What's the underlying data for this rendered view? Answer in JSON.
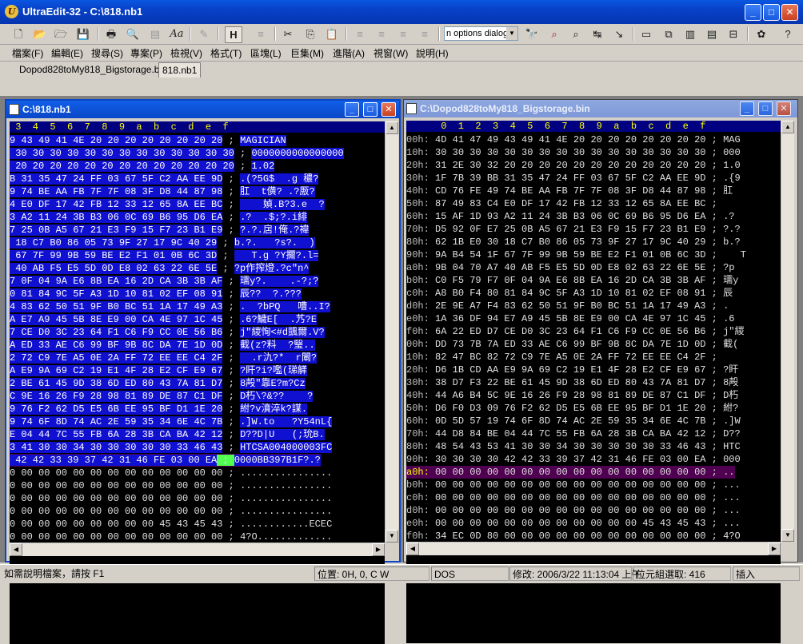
{
  "window": {
    "title": "UltraEdit-32 - C:\\818.nb1"
  },
  "toolbar": {
    "search_combo": "n options dialog"
  },
  "menu": [
    "檔案(F)",
    "編輯(E)",
    "搜尋(S)",
    "專案(P)",
    "檢視(V)",
    "格式(T)",
    "區塊(L)",
    "巨集(M)",
    "進階(A)",
    "視窗(W)",
    "說明(H)"
  ],
  "tabs": [
    "Dopod828toMy818_Bigstorage.bin",
    "818.nb1"
  ],
  "left_pane": {
    "title": "C:\\818.nb1",
    "header": " 3  4  5  6  7  8  9  a  b  c  d  e  f",
    "rows": [
      [
        "9 43 49 41 4E 20 20 20 20 20 20 20 20",
        "MAGICIAN"
      ],
      [
        " 30 30 30 30 30 30 30 30 30 30 30 30 30",
        "0000000000000000"
      ],
      [
        " 20 20 20 20 20 20 20 20 20 20 20 20 20",
        "1.02"
      ],
      [
        "B 31 35 47 24 FF 03 67 5F C2 AA EE 9D",
        ".(?5G$  .g 穠?"
      ],
      [
        "9 74 BE AA FB 7F 7F 08 3F D8 44 87 98",
        "肛  t僙? .?厫?"
      ],
      [
        "4 E0 DF 17 42 FB 12 33 12 65 8A EE BC",
        "    媜.B?3.e  ?"
      ],
      [
        "3 A2 11 24 3B B3 06 0C 69 B6 95 D6 EA",
        ".?  .$;?.i緋"
      ],
      [
        "7 25 0B A5 67 21 E3 F9 15 F7 23 B1 E9",
        "?.?.扂!俺.?禕"
      ],
      [
        " 18 C7 B0 86 05 73 9F 27 17 9C 40 29",
        "b.?.   ?s?.  )"
      ],
      [
        " 67 7F 99 9B 59 BE E2 F1 01 0B 6C 3D",
        "   T.g ?Y擟?.l="
      ],
      [
        " 40 AB F5 E5 5D 0D E8 02 63 22 6E 5E",
        "?p作搾燈.?c\"n^"
      ],
      [
        "7 0F 04 9A E6 8B EA 16 2D CA 3B 3B AF",
        "瓀y?.    .-?;?"
      ],
      [
        "0 81 84 9C 5F A3 1D 10 81 02 EF 08 91",
        "辰??  ?.???"
      ],
      [
        "4 83 62 50 51 9F B0 BC 51 1A 17 49 A3",
        ".  ?bPQ   嘈..I?"
      ],
      [
        "A E7 A9 45 5B 8E E9 00 CA 4E 97 1C 45",
        ".6?鱥E[  .艿?E"
      ],
      [
        "7 CE D0 3C 23 64 F1 C6 F9 CC 0E 56 B6",
        "j\"緵恂<#d颽爾.V?"
      ],
      [
        "A ED 33 AE C6 99 BF 9B 8C DA 7E 1D 0D",
        "截(z?料  ?瑿.."
      ],
      [
        "2 72 C9 7E A5 0E 2A FF 72 EE EE C4 2F",
        "  .r氿?*  r閳?"
      ],
      [
        "A E9 9A 69 C2 19 E1 4F 28 E2 CF E9 67",
        "?盰?i?嚂(珶觲"
      ],
      [
        "2 BE 61 45 9D 38 6D ED 80 43 7A 81 D7",
        "8殸\"靠E?m?Cz"
      ],
      [
        "C 9E 16 26 F9 28 98 81 89 DE 87 C1 DF",
        "D朽\\?&??    ?"
      ],
      [
        "9 76 F2 62 D5 E5 6B EE 95 BF D1 1E 20",
        "紨?v濆淬k?謀."
      ],
      [
        "9 74 6F 8D 74 AC 2E 59 35 34 6E 4C 7B",
        ".]W.to   ?Y54nL{"
      ],
      [
        "E 04 44 7C 55 FB 6A 28 3B CA BA 42 12",
        "D??D|U   (;玧B."
      ],
      [
        "3 41 30 30 34 30 30 30 30 30 33 46 43",
        "HTCSA004000003FC"
      ],
      [
        " 42 42 33 39 37 42 31 46 FE 03 00 EA",
        "0000BB397B1F?.?"
      ],
      [
        "0 00 00 00 00 00 00 00 00 00 00 00 00",
        "................"
      ],
      [
        "0 00 00 00 00 00 00 00 00 00 00 00 00",
        "................"
      ],
      [
        "0 00 00 00 00 00 00 00 00 00 00 00 00",
        "................"
      ],
      [
        "0 00 00 00 00 00 00 00 00 00 00 00 00",
        "................"
      ],
      [
        "0 00 00 00 00 00 00 00 00 45 43 45 43",
        "............ECEC"
      ],
      [
        "0 00 00 00 00 00 00 00 00 00 00 00 00",
        "4?O............."
      ]
    ]
  },
  "right_pane": {
    "title": "C:\\Dopod828toMy818_Bigstorage.bin",
    "header": "      0  1  2  3  4  5  6  7  8  9  a  b  c  d  e  f",
    "rows": [
      [
        "00h:",
        "4D 41 47 49 43 49 41 4E 20 20 20 20 20 20 20 20",
        "MAG"
      ],
      [
        "10h:",
        "30 30 30 30 30 30 30 30 30 30 30 30 30 30 30 30",
        "000"
      ],
      [
        "20h:",
        "31 2E 30 32 20 20 20 20 20 20 20 20 20 20 20 20",
        "1.0"
      ],
      [
        "30h:",
        "1F 7B 39 BB 31 35 47 24 FF 03 67 5F C2 AA EE 9D",
        ".{9"
      ],
      [
        "40h:",
        "CD 76 FE 49 74 BE AA FB 7F 7F 08 3F D8 44 87 98",
        "肛"
      ],
      [
        "50h:",
        "87 49 83 C4 E0 DF 17 42 FB 12 33 12 65 8A EE BC",
        ""
      ],
      [
        "60h:",
        "15 AF 1D 93 A2 11 24 3B B3 06 0C 69 B6 95 D6 EA",
        ".?"
      ],
      [
        "70h:",
        "D5 92 0F E7 25 0B A5 67 21 E3 F9 15 F7 23 B1 E9",
        "?.?"
      ],
      [
        "80h:",
        "62 1B E0 30 18 C7 B0 86 05 73 9F 27 17 9C 40 29",
        "b.?"
      ],
      [
        "90h:",
        "9A B4 54 1F 67 7F 99 9B 59 BE E2 F1 01 0B 6C 3D",
        "   T"
      ],
      [
        "a0h:",
        "9B 04 70 A7 40 AB F5 E5 5D 0D E8 02 63 22 6E 5E",
        "?p"
      ],
      [
        "b0h:",
        "C0 F5 79 F7 0F 04 9A E6 8B EA 16 2D CA 3B 3B AF",
        "瓀y"
      ],
      [
        "c0h:",
        "A8 B0 F4 80 81 84 9C 5F A3 1D 10 81 02 EF 08 91",
        "辰"
      ],
      [
        "d0h:",
        "2E 9E A7 F4 83 62 50 51 9F B0 BC 51 1A 17 49 A3",
        "."
      ],
      [
        "e0h:",
        "1A 36 DF 94 E7 A9 45 5B 8E E9 00 CA 4E 97 1C 45",
        ".6"
      ],
      [
        "f0h:",
        "6A 22 ED D7 CE D0 3C 23 64 F1 C6 F9 CC 0E 56 B6",
        "j\"緵"
      ],
      [
        "00h:",
        "DD 73 7B 7A ED 33 AE C6 99 BF 9B 8C DA 7E 1D 0D",
        "截("
      ],
      [
        "10h:",
        "82 47 BC 82 72 C9 7E A5 0E 2A FF 72 EE EE C4 2F",
        ""
      ],
      [
        "20h:",
        "D6 1B CD AA E9 9A 69 C2 19 E1 4F 28 E2 CF E9 67",
        "?盰"
      ],
      [
        "30h:",
        "38 D7 F3 22 BE 61 45 9D 38 6D ED 80 43 7A 81 D7",
        "8殸"
      ],
      [
        "40h:",
        "44 A6 B4 5C 9E 16 26 F9 28 98 81 89 DE 87 C1 DF",
        "D朽"
      ],
      [
        "50h:",
        "D6 F0 D3 09 76 F2 62 D5 E5 6B EE 95 BF D1 1E 20",
        "紨?"
      ],
      [
        "60h:",
        "0D 5D 57 19 74 6F 8D 74 AC 2E 59 35 34 6E 4C 7B",
        ".]W"
      ],
      [
        "70h:",
        "44 D8 84 BE 04 44 7C 55 FB 6A 28 3B CA BA 42 12",
        "D??"
      ],
      [
        "80h:",
        "48 54 43 53 41 30 30 34 30 30 30 30 30 33 46 43",
        "HTC"
      ],
      [
        "90h:",
        "30 30 30 30 42 42 33 39 37 42 31 46 FE 03 00 EA",
        "000"
      ],
      [
        "a0h:",
        "00 00 00 00 00 00 00 00 00 00 00 00 00 00 00 00",
        ".."
      ],
      [
        "b0h:",
        "00 00 00 00 00 00 00 00 00 00 00 00 00 00 00 00",
        "..."
      ],
      [
        "c0h:",
        "00 00 00 00 00 00 00 00 00 00 00 00 00 00 00 00",
        "..."
      ],
      [
        "d0h:",
        "00 00 00 00 00 00 00 00 00 00 00 00 00 00 00 00",
        "..."
      ],
      [
        "e0h:",
        "00 00 00 00 00 00 00 00 00 00 00 00 45 43 45 43",
        "..."
      ],
      [
        "f0h:",
        "34 EC 0D 80 00 00 00 00 00 00 00 00 00 00 00 00",
        "4?O"
      ]
    ]
  },
  "status": {
    "help": "如需說明檔案，請按 F1",
    "pos": "位置: 0H, 0, C W",
    "format": "DOS",
    "modified": "修改: 2006/3/22 11:13:04 上午",
    "selection": "位元組選取: 416",
    "mode": "插入"
  }
}
